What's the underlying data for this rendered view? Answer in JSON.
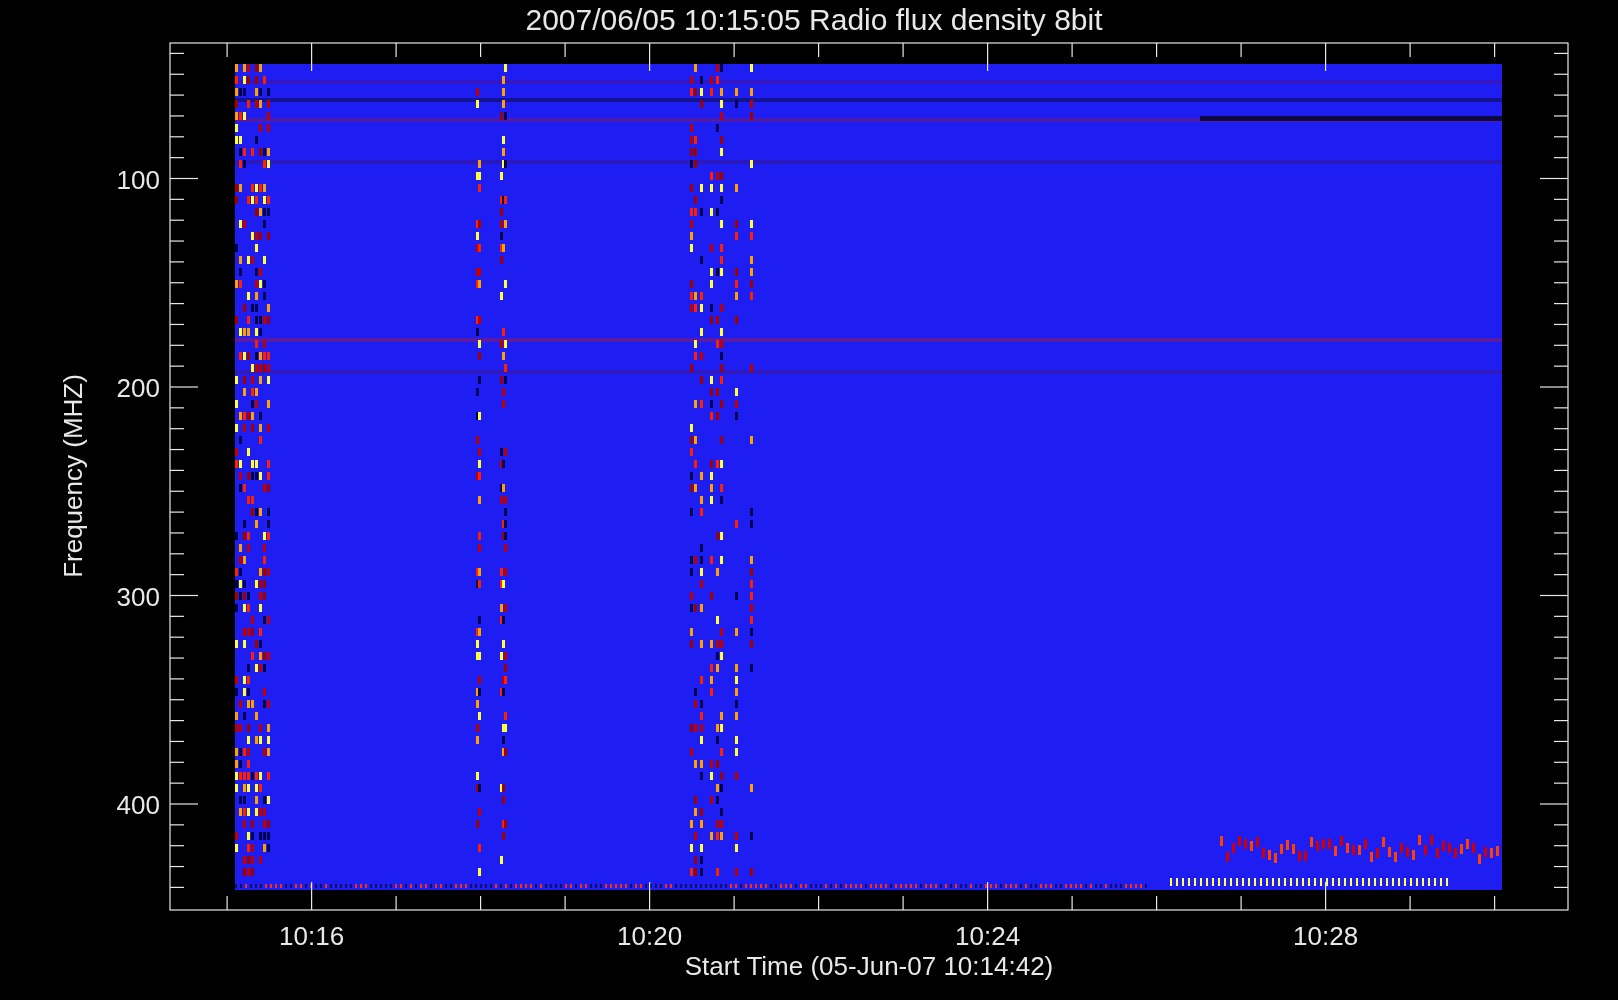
{
  "title": "2007/06/05 10:15:05 Radio flux density 8bit",
  "plot": {
    "ylabel": "Frequency (MHZ)",
    "yticks": [
      "100",
      "200",
      "300",
      "400"
    ],
    "xticks": [
      "10:16",
      "10:20",
      "10:24",
      "10:28"
    ],
    "xlabel": "Start Time (05-Jun-07 10:14:42)"
  }
}
